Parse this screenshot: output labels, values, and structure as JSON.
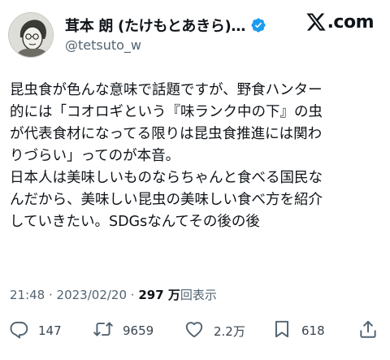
{
  "header": {
    "display_name": "茸本 朗 (たけもとあきら)…",
    "handle": "@tetsuto_w",
    "brand_text": ".com",
    "verified_color": "#1d9bf0"
  },
  "tweet": {
    "lines": [
      "昆虫食が色んな意味で話題ですが、野食ハンター",
      "的には「コオロギという『味ランク中の下』の虫",
      "が代表食材になってる限りは昆虫食推進には関わ",
      "りづらい」ってのが本音。",
      "日本人は美味しいものならちゃんと食べる国民な",
      "んだから、美味しい昆虫の美味しい食べ方を紹介",
      "していきたい。SDGsなんてその後の後"
    ]
  },
  "meta": {
    "time": "21:48",
    "separator1": " · ",
    "date": "2023/02/20",
    "separator2": " · ",
    "views_value": "297 万",
    "views_label": "回表示"
  },
  "actions": {
    "replies": "147",
    "retweets": "9659",
    "likes": "2.2万",
    "bookmarks": "618",
    "icons": [
      "reply-icon",
      "retweet-icon",
      "like-icon",
      "bookmark-icon",
      "share-icon"
    ]
  }
}
